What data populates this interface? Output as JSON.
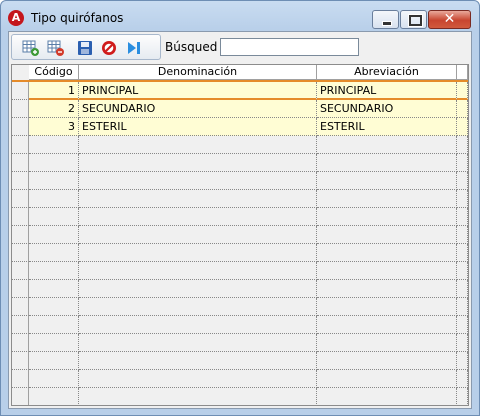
{
  "window": {
    "title": "Tipo quirófanos",
    "app_icon_letter": "A",
    "accent_color": "#c4161c"
  },
  "toolbar": {
    "buttons": [
      {
        "name": "add-row-icon",
        "color": "#3d9a36"
      },
      {
        "name": "delete-row-icon",
        "color": "#d23a2a"
      },
      {
        "name": "save-icon",
        "color": "#2b5fb0"
      },
      {
        "name": "cancel-icon",
        "color": "#d01c1c"
      },
      {
        "name": "last-record-icon",
        "color": "#2a8ee0"
      }
    ],
    "search_label": "Búsqued",
    "search_value": ""
  },
  "grid": {
    "columns": [
      "Código",
      "Denominación",
      "Abreviación"
    ],
    "selection_color": "#e58b2a",
    "row_color": "#fffdd4",
    "rows": [
      {
        "code": "1",
        "name": "PRINCIPAL",
        "abbr": "PRINCIPAL"
      },
      {
        "code": "2",
        "name": "SECUNDARIO",
        "abbr": "SECUNDARIO"
      },
      {
        "code": "3",
        "name": "ESTERIL",
        "abbr": "ESTERIL"
      }
    ]
  }
}
